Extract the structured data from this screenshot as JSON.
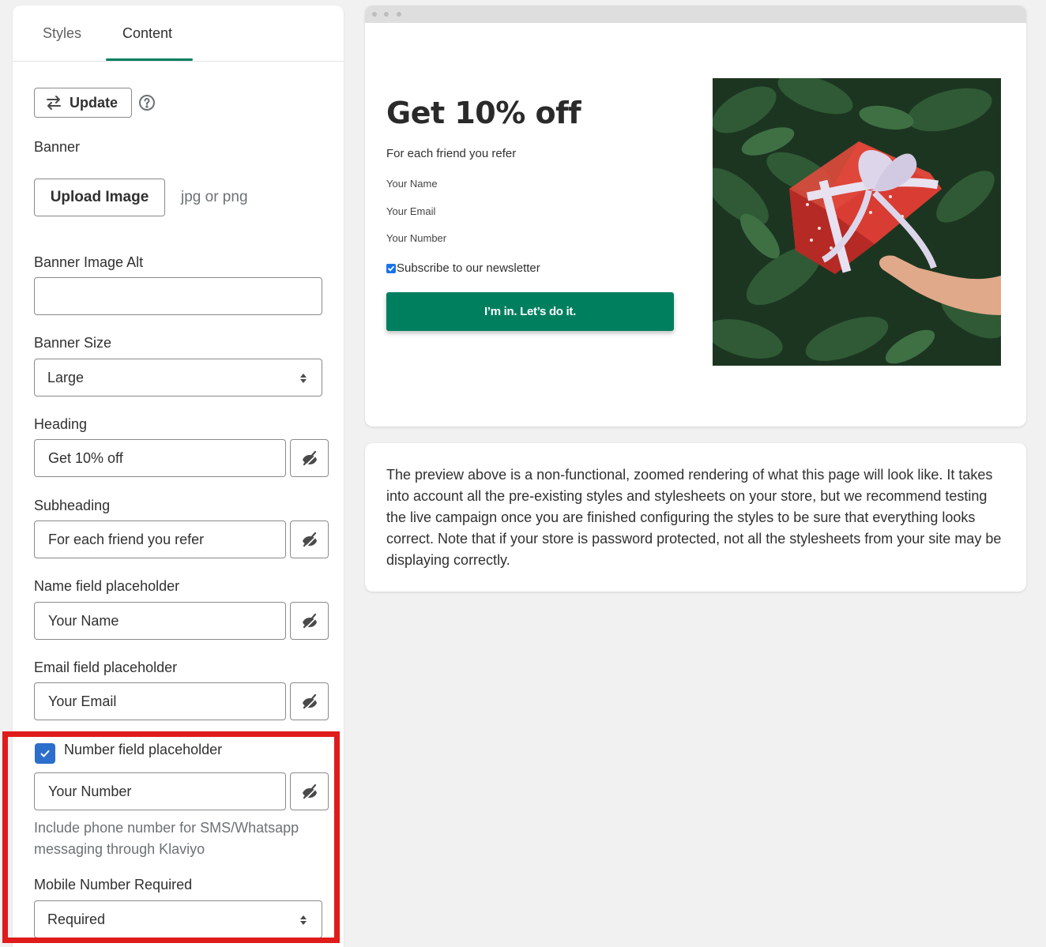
{
  "tabs": [
    {
      "label": "Styles",
      "active": false
    },
    {
      "label": "Content",
      "active": true
    }
  ],
  "toolbar": {
    "update_label": "Update"
  },
  "banner": {
    "label": "Banner",
    "upload_label": "Upload Image",
    "upload_hint": "jpg or png"
  },
  "banner_alt": {
    "label": "Banner Image Alt",
    "value": ""
  },
  "banner_size": {
    "label": "Banner Size",
    "value": "Large"
  },
  "heading": {
    "label": "Heading",
    "value": "Get 10% off"
  },
  "subheading": {
    "label": "Subheading",
    "value": "For each friend you refer"
  },
  "name_field": {
    "label": "Name field placeholder",
    "value": "Your Name"
  },
  "email_field": {
    "label": "Email field placeholder",
    "value": "Your Email"
  },
  "number_field": {
    "label": "Number field placeholder",
    "checked": true,
    "value": "Your Number",
    "help": "Include phone number for SMS/Whatsapp messaging through Klaviyo"
  },
  "mobile_required": {
    "label": "Mobile Number Required",
    "value": "Required"
  },
  "preview": {
    "heading": "Get 10% off",
    "subheading": "For each friend you refer",
    "name_placeholder": "Your Name",
    "email_placeholder": "Your Email",
    "number_placeholder": "Your Number",
    "subscribe_label": "Subscribe to our newsletter",
    "subscribe_checked": true,
    "cta_label": "I’m in. Let’s do it."
  },
  "note": "The preview above is a non-functional, zoomed rendering of what this page will look like. It takes into account all the pre-existing styles and stylesheets on your store, but we recommend testing the live campaign once you are finished configuring the styles to be sure that everything looks correct. Note that if your store is password protected, not all the stylesheets from your site may be displaying correctly.",
  "colors": {
    "accent": "#008060",
    "cta": "#007f5f",
    "checkbox": "#2c6ecb",
    "highlight": "#e01b1b"
  },
  "icons": [
    "arrows-exchange-icon",
    "help-circle-icon",
    "hide-icon",
    "select-arrows-icon",
    "checkmark-icon"
  ]
}
